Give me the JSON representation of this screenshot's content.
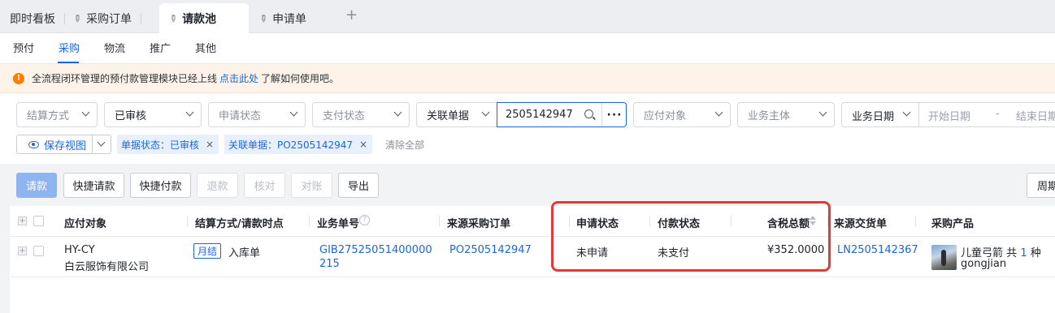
{
  "tabs": [
    {
      "label": "即时看板"
    },
    {
      "label": "采购订单"
    },
    {
      "label": "请款池"
    },
    {
      "label": "申请单"
    }
  ],
  "add_tab": "+",
  "subnav": [
    "预付",
    "采购",
    "物流",
    "推广",
    "其他"
  ],
  "notice": {
    "icon": "!",
    "text_before": "全流程闭环管理的预付款管理模块已经上线",
    "link": "点击此处",
    "text_after": "了解如何使用吧。"
  },
  "filters": {
    "settlement": "结算方式",
    "review": "已审核",
    "apply_status": "申请状态",
    "pay_status": "支付状态",
    "related_doc": "关联单据",
    "search_value": "2505142947",
    "more": "···",
    "payee": "应付对象",
    "entity": "业务主体",
    "date_type": "业务日期",
    "start_date": "开始日期",
    "date_sep": "-",
    "end_date": "结束日期"
  },
  "chips": {
    "save_view": "保存视图",
    "chip1": "单据状态：已审核",
    "chip2": "关联单据：PO2505142947",
    "clear_all": "清除全部",
    "x": "×"
  },
  "toolbar": {
    "request": "请款",
    "quick_request": "快捷请款",
    "quick_pay": "快捷付款",
    "refund": "退款",
    "verify": "核对",
    "reconcile": "对账",
    "export": "导出",
    "period": "周期"
  },
  "table": {
    "headers": {
      "payee": "应付对象",
      "settlement": "结算方式/请款时点",
      "biz_no": "业务单号",
      "source_po": "来源采购订单",
      "apply_status": "申请状态",
      "pay_status": "付款状态",
      "total_tax": "含税总额",
      "source_delivery": "来源交货单",
      "product": "采购产品"
    },
    "row": {
      "payee_code": "HY-CY",
      "payee_name": "白云服饰有限公司",
      "tag": "月结",
      "timing": "入库单",
      "biz_no_1": "GIB27525051400000",
      "biz_no_2": "215",
      "source_po": "PO2505142947",
      "apply_status": "未申请",
      "pay_status": "未支付",
      "total_tax": "¥352.0000",
      "source_delivery": "LN2505142367",
      "product_name": "儿童弓箭",
      "product_count_prefix": "共",
      "product_count": "1",
      "product_count_suffix": "种",
      "product_sku": "gongjian"
    }
  },
  "colors": {
    "accent": "#1a66e0",
    "highlight_box": "#e53935",
    "notice_bg": "#fdf3e9",
    "warning_icon": "#ff7d00"
  }
}
